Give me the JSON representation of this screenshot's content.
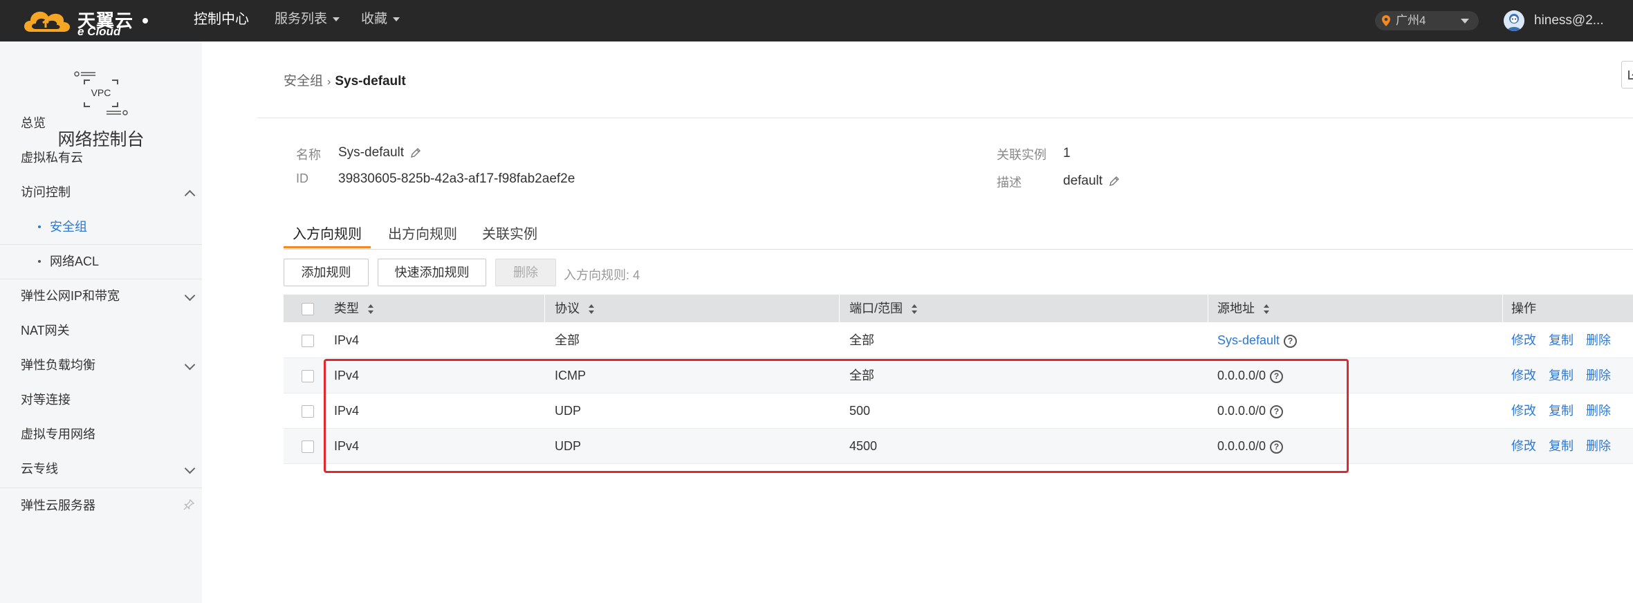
{
  "header": {
    "logo_cn": "天翼云",
    "logo_en": "e Cloud",
    "nav": [
      {
        "label": "控制中心",
        "active": true
      },
      {
        "label": "服务列表",
        "dropdown": true
      },
      {
        "label": "收藏",
        "dropdown": true
      }
    ],
    "region": "广州4",
    "username": "hiness@2..."
  },
  "sidebar": {
    "icon_label": "VPC",
    "title": "网络控制台",
    "items": [
      {
        "label": "总览"
      },
      {
        "label": "虚拟私有云"
      },
      {
        "label": "访问控制",
        "expanded": true
      },
      {
        "label": "安全组",
        "sub": true,
        "active": true
      },
      {
        "label": "网络ACL",
        "sub": true
      },
      {
        "label": "弹性公网IP和带宽",
        "expandable": true
      },
      {
        "label": "NAT网关"
      },
      {
        "label": "弹性负载均衡",
        "expandable": true
      },
      {
        "label": "对等连接"
      },
      {
        "label": "虚拟专用网络"
      },
      {
        "label": "云专线",
        "expandable": true
      },
      {
        "label": "弹性云服务器"
      }
    ]
  },
  "breadcrumb": {
    "parent": "安全组",
    "separator": "›",
    "current": "Sys-default"
  },
  "info": {
    "name_label": "名称",
    "name_value": "Sys-default",
    "id_label": "ID",
    "id_value": "39830605-825b-42a3-af17-f98fab2aef2e",
    "instances_label": "关联实例",
    "instances_value": "1",
    "desc_label": "描述",
    "desc_value": "default"
  },
  "tabs": [
    {
      "label": "入方向规则",
      "active": true
    },
    {
      "label": "出方向规则"
    },
    {
      "label": "关联实例"
    }
  ],
  "toolbar": {
    "add_label": "添加规则",
    "quick_add_label": "快速添加规则",
    "delete_label": "删除",
    "count_text": "入方向规则:  4"
  },
  "table": {
    "headers": [
      "类型",
      "协议",
      "端口/范围",
      "源地址",
      "操作"
    ],
    "rows": [
      {
        "type": "IPv4",
        "protocol": "全部",
        "port": "全部",
        "source": "Sys-default",
        "source_is_link": true
      },
      {
        "type": "IPv4",
        "protocol": "ICMP",
        "port": "全部",
        "source": "0.0.0.0/0",
        "source_is_link": false
      },
      {
        "type": "IPv4",
        "protocol": "UDP",
        "port": "500",
        "source": "0.0.0.0/0",
        "source_is_link": false
      },
      {
        "type": "IPv4",
        "protocol": "UDP",
        "port": "4500",
        "source": "0.0.0.0/0",
        "source_is_link": false
      }
    ],
    "actions": [
      "修改",
      "复制",
      "删除"
    ],
    "help_glyph": "?"
  },
  "colors": {
    "topbar": "#282828",
    "accent_orange": "#f08a24",
    "link_blue": "#2c78d4",
    "highlight_red": "#e0282e"
  }
}
